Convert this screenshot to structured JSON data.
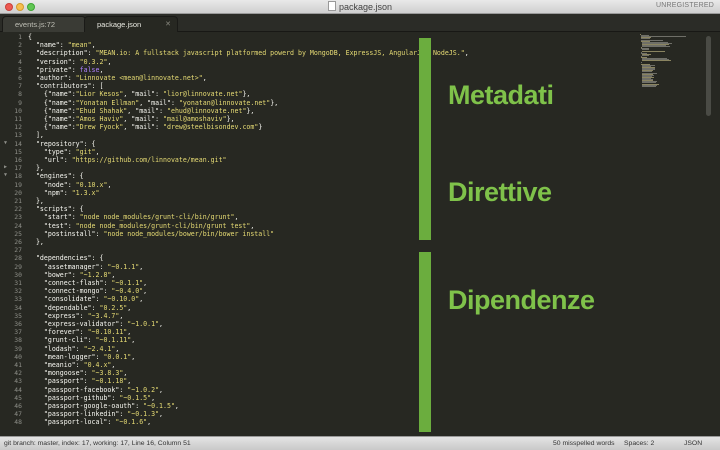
{
  "window": {
    "title": "package.json",
    "unregistered": "UNREGISTERED"
  },
  "tabs": [
    {
      "label": "events.js:72",
      "active": false
    },
    {
      "label": "package.json",
      "active": true
    }
  ],
  "editor": {
    "gutter_marks": {
      "14": "▼",
      "17": "▶",
      "18": "▼"
    },
    "lines": [
      {
        "n": "1",
        "t": "{"
      },
      {
        "n": "2",
        "t": "  \"name\": \"mean\","
      },
      {
        "n": "3",
        "t": "  \"description\": \"MEAN.io: A fullstack javascript platformed powerd by MongoDB, ExpressJS, AngularJS, NodeJS.\","
      },
      {
        "n": "4",
        "t": "  \"version\": \"0.3.2\","
      },
      {
        "n": "5",
        "t": "  \"private\": false,"
      },
      {
        "n": "6",
        "t": "  \"author\": \"Linnovate <mean@linnovate.net>\","
      },
      {
        "n": "7",
        "t": "  \"contributors\": ["
      },
      {
        "n": "8",
        "t": "    {\"name\":\"Lior Kesos\", \"mail\": \"lior@linnovate.net\"},"
      },
      {
        "n": "9",
        "t": "    {\"name\":\"Yonatan Ellman\", \"mail\": \"yonatan@linnovate.net\"},"
      },
      {
        "n": "10",
        "t": "    {\"name\":\"Ehud Shahak\", \"mail\": \"ehud@linnovate.net\"},"
      },
      {
        "n": "11",
        "t": "    {\"name\":\"Amos Haviv\", \"mail\": \"mail@amoshaviv\"},"
      },
      {
        "n": "12",
        "t": "    {\"name\":\"Drew Fyock\", \"mail\": \"drew@steelbisondev.com\"}"
      },
      {
        "n": "13",
        "t": "  ],"
      },
      {
        "n": "14",
        "t": "  \"repository\": {"
      },
      {
        "n": "15",
        "t": "    \"type\": \"git\","
      },
      {
        "n": "16",
        "t": "    \"url\": \"https://github.com/linnovate/mean.git\""
      },
      {
        "n": "17",
        "t": "  },"
      },
      {
        "n": "18",
        "t": "  \"engines\": {"
      },
      {
        "n": "19",
        "t": "    \"node\": \"0.10.x\","
      },
      {
        "n": "20",
        "t": "    \"npm\": \"1.3.x\""
      },
      {
        "n": "21",
        "t": "  },"
      },
      {
        "n": "22",
        "t": "  \"scripts\": {"
      },
      {
        "n": "23",
        "t": "    \"start\": \"node node_modules/grunt-cli/bin/grunt\","
      },
      {
        "n": "24",
        "t": "    \"test\": \"node node_modules/grunt-cli/bin/grunt test\","
      },
      {
        "n": "25",
        "t": "    \"postinstall\": \"node node_modules/bower/bin/bower install\""
      },
      {
        "n": "26",
        "t": "  },"
      },
      {
        "n": "27",
        "t": ""
      },
      {
        "n": "28",
        "t": "  \"dependencies\": {"
      },
      {
        "n": "29",
        "t": "    \"assetmanager\": \"~0.1.1\","
      },
      {
        "n": "30",
        "t": "    \"bower\": \"~1.2.8\","
      },
      {
        "n": "31",
        "t": "    \"connect-flash\": \"~0.1.1\","
      },
      {
        "n": "32",
        "t": "    \"connect-mongo\": \"~0.4.0\","
      },
      {
        "n": "33",
        "t": "    \"consolidate\": \"~0.10.0\","
      },
      {
        "n": "34",
        "t": "    \"dependable\": \"0.2.5\","
      },
      {
        "n": "35",
        "t": "    \"express\": \"~3.4.7\","
      },
      {
        "n": "36",
        "t": "    \"express-validator\": \"~1.0.1\","
      },
      {
        "n": "37",
        "t": "    \"forever\": \"~0.10.11\","
      },
      {
        "n": "38",
        "t": "    \"grunt-cli\": \"~0.1.11\","
      },
      {
        "n": "39",
        "t": "    \"lodash\": \"~2.4.1\","
      },
      {
        "n": "40",
        "t": "    \"mean-logger\": \"0.0.1\","
      },
      {
        "n": "41",
        "t": "    \"meanio\": \"0.4.x\","
      },
      {
        "n": "42",
        "t": "    \"mongoose\": \"~3.8.3\","
      },
      {
        "n": "43",
        "t": "    \"passport\": \"~0.1.18\","
      },
      {
        "n": "44",
        "t": "    \"passport-facebook\": \"~1.0.2\","
      },
      {
        "n": "45",
        "t": "    \"passport-github\": \"~0.1.5\","
      },
      {
        "n": "46",
        "t": "    \"passport-google-oauth\": \"~0.1.5\","
      },
      {
        "n": "47",
        "t": "    \"passport-linkedin\": \"~0.1.3\","
      },
      {
        "n": "48",
        "t": "    \"passport-local\": \"~0.1.6\","
      }
    ]
  },
  "overlays": [
    {
      "label": "Metadati",
      "color": "#7fc24a"
    },
    {
      "label": "Direttive",
      "color": "#7fc24a"
    },
    {
      "label": "Dipendenze",
      "color": "#7fc24a"
    }
  ],
  "status": {
    "branch": "git branch: master, index: 17, working: 17, Line 16, Column 51",
    "misspelled": "50 misspelled words",
    "spaces": "Spaces: 2",
    "syntax": "JSON"
  },
  "colors": {
    "key": "#f8f8f2",
    "string": "#e6db74",
    "keyword": "#ae81ff",
    "accent_bar": "#6bad3e"
  }
}
